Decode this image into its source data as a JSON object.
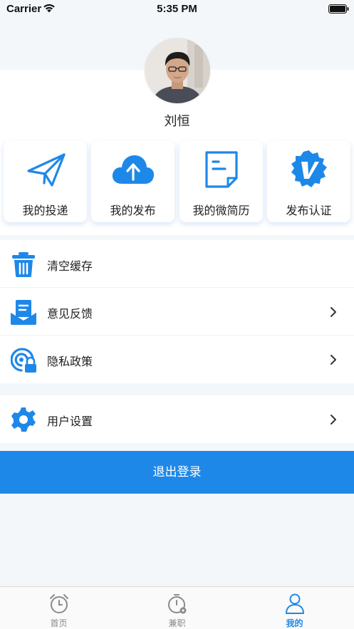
{
  "status_bar": {
    "carrier": "Carrier",
    "time": "5:35 PM"
  },
  "profile": {
    "name": "刘恒"
  },
  "actions": [
    {
      "label": "我的投递",
      "icon": "paper-plane-icon"
    },
    {
      "label": "我的发布",
      "icon": "cloud-upload-icon"
    },
    {
      "label": "我的微简历",
      "icon": "resume-document-icon"
    },
    {
      "label": "发布认证",
      "icon": "verified-badge-icon"
    }
  ],
  "menu": {
    "group1": [
      {
        "label": "清空缓存",
        "icon": "trash-icon",
        "has_chevron": false
      },
      {
        "label": "意见反馈",
        "icon": "feedback-mail-icon",
        "has_chevron": true
      },
      {
        "label": "隐私政策",
        "icon": "privacy-lock-icon",
        "has_chevron": true
      }
    ],
    "group2": [
      {
        "label": "用户设置",
        "icon": "gear-icon",
        "has_chevron": true
      }
    ]
  },
  "logout_label": "退出登录",
  "tabbar": [
    {
      "label": "首页",
      "icon": "alarm-clock-icon",
      "active": false
    },
    {
      "label": "兼职",
      "icon": "stopwatch-icon",
      "active": false
    },
    {
      "label": "我的",
      "icon": "person-icon",
      "active": true
    }
  ],
  "colors": {
    "accent": "#1e88e8",
    "background": "#f4f7f9",
    "inactive_tab": "#8a8a8a"
  }
}
